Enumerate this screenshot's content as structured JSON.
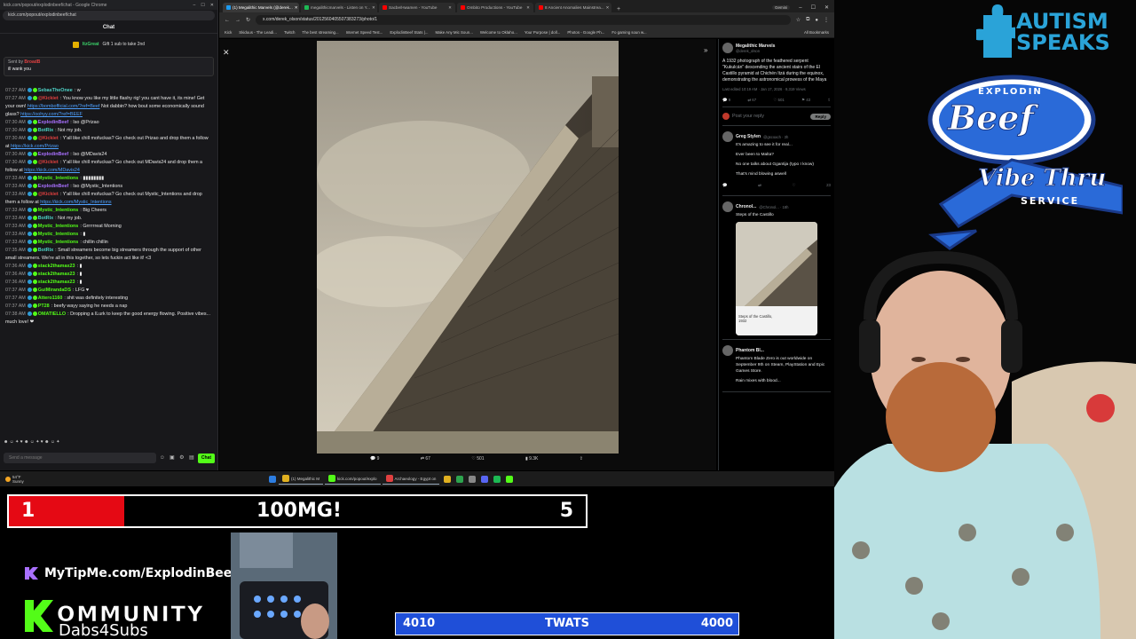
{
  "chat": {
    "window_title": "kick.com/popout/explodinbeef/chat - Google Chrome",
    "url": "kick.com/popout/explodinbeef/chat",
    "header": "Chat",
    "pinned": {
      "user": "ItzGreat",
      "text": "Gift 1 sub to take 2nd"
    },
    "reply": {
      "sent_by": "Sent by",
      "sender": "BroadB",
      "message": "ill wank you"
    },
    "messages": [
      {
        "time": "07:27 AM",
        "user": "SebasTheOnee",
        "color": "#4ed4c8",
        "text": "w"
      },
      {
        "time": "07:27 AM",
        "user": "@Kickiet",
        "color": "#e04040",
        "text": "You know you like my little flashy rig! you cant have it, its mine! Get your own!",
        "link": "https://bombofficial.com/?ref=Beef",
        "after": "Not dabbin? how bout some economically sound glass?",
        "link2": "https://oohyy.com/?ref=BEEF"
      },
      {
        "time": "07:30 AM",
        "user": "ExplodinBeef",
        "color": "#a970ff",
        "text": "Iso @Prizao"
      },
      {
        "time": "07:30 AM",
        "user": "BotRix",
        "color": "#4ed4c8",
        "text": "Not my job."
      },
      {
        "time": "07:30 AM",
        "user": "@Kickiet",
        "color": "#e04040",
        "text": "Y'all like chill mofuckas? Go check out Prizao and drop them a follow at",
        "link": "https://kick.com/Prizao"
      },
      {
        "time": "07:30 AM",
        "user": "ExplodinBeef",
        "color": "#a970ff",
        "text": "Iso @MDavis24"
      },
      {
        "time": "07:30 AM",
        "user": "@Kickiet",
        "color": "#e04040",
        "text": "Y'all like chill mofuckas? Go check out MDavis24 and drop them a follow at",
        "link": "https://kick.com/MDavis24"
      },
      {
        "time": "07:33 AM",
        "user": "Mystic_Intentions",
        "color": "#53fc18",
        "text": "▮▮▮▮▮▮▮▮"
      },
      {
        "time": "07:33 AM",
        "user": "ExplodinBeef",
        "color": "#a970ff",
        "text": "Iso @Mystic_Intentions"
      },
      {
        "time": "07:33 AM",
        "user": "@Kickiet",
        "color": "#e04040",
        "text": "Y'all like chill mofuckas? Go check out Mystic_Intentions and drop them a follow at",
        "link": "https://kick.com/Mystic_Intentions"
      },
      {
        "time": "07:33 AM",
        "user": "Mystic_Intentions",
        "color": "#53fc18",
        "text": "Big Cheers"
      },
      {
        "time": "07:33 AM",
        "user": "BotRix",
        "color": "#4ed4c8",
        "text": "Not my job."
      },
      {
        "time": "07:33 AM",
        "user": "Mystic_Intentions",
        "color": "#53fc18",
        "text": "Grrrrrreat Morning"
      },
      {
        "time": "07:33 AM",
        "user": "Mystic_Intentions",
        "color": "#53fc18",
        "text": "▮"
      },
      {
        "time": "07:33 AM",
        "user": "Mystic_Intentions",
        "color": "#53fc18",
        "text": "chillin chillin"
      },
      {
        "time": "07:35 AM",
        "user": "BotRix",
        "color": "#4ed4c8",
        "text": "Small streamers become big streamers through the support of other small streamers. We're all in this together, so lets fuckin act like it! <3"
      },
      {
        "time": "07:36 AM",
        "user": "stack2thamax23",
        "color": "#53fc18",
        "text": "▮"
      },
      {
        "time": "07:36 AM",
        "user": "stack2thamax23",
        "color": "#53fc18",
        "text": "▮"
      },
      {
        "time": "07:36 AM",
        "user": "stack2thamax23",
        "color": "#53fc18",
        "text": "▮"
      },
      {
        "time": "07:37 AM",
        "user": "GuiMirandaDS",
        "color": "#53fc18",
        "text": "LFG ♥"
      },
      {
        "time": "07:37 AM",
        "user": "Attero1160",
        "color": "#53fc18",
        "text": "shit was definitely interesting"
      },
      {
        "time": "07:37 AM",
        "user": "PT28",
        "color": "#53fc18",
        "text": "beefy wayy saying he needs a nap"
      },
      {
        "time": "07:38 AM",
        "user": "OMATIELLO",
        "color": "#53fc18",
        "text": "Dropping a lLurk to keep the good energy flowing. Positive vibes... much love! ❤"
      }
    ],
    "input_placeholder": "Send a message",
    "send_label": "Chat"
  },
  "browser": {
    "tabs": [
      {
        "label": "(1) Megalithic Marvels (@derek...",
        "color": "#1d9bf0",
        "active": true
      },
      {
        "label": "megalithicmarvels - Listen on Y...",
        "color": "#1db954",
        "active": false
      },
      {
        "label": "Sacbe/Hwamen - YouTube",
        "color": "#ff0000",
        "active": false
      },
      {
        "label": "Ombito Productions - YouTube",
        "color": "#ff0000",
        "active": false
      },
      {
        "label": "8 Ancient Anomalies Mainstrea...",
        "color": "#ff0000",
        "active": false
      }
    ],
    "gemini_label": "Gemini",
    "url": "x.com/derek_olson/status/2012560405507383273/photo/1",
    "bookmarks": [
      "Kick",
      "Skiduus - The Leadi...",
      "Twitch",
      "The best streaming...",
      "Internet Speed Test...",
      "ExplodinBeef Stats |...",
      "Make Any Mic Soun...",
      "Welcome to Oklaho...",
      "Your Purpose | doll...",
      "Photos - Google Ph...",
      "Fo gaming soun w..."
    ],
    "all_bookmarks": "All Bookmarks",
    "photo_actions": {
      "replies": "9",
      "reposts": "67",
      "likes": "501",
      "views": "9.3K"
    },
    "tweet": {
      "name": "Megalithic Marvels",
      "handle": "@derek_olson",
      "text": "A 1932 photograph of the feathered serpent \"Kukulcán\" descending the ancient stairs of the El Castillo pyramid at Chichén Itzá during the equinox, demonstrating the astronomical prowess of the Maya",
      "meta": "Last edited 10:19 AM · Jan 17, 2026 · 9,319 Views",
      "stats": {
        "replies": "9",
        "reposts": "67",
        "likes": "501",
        "bookmarks": "43"
      },
      "reply_placeholder": "Post your reply",
      "reply_button": "Reply"
    },
    "replies": [
      {
        "name": "Greg Stylen",
        "handle": "@gscoach · 3h",
        "lines": [
          "It's amazing to see it for real...",
          "Ever been to Malta?",
          "No one talks about Ggantija (typo I know)",
          "That's mind blowing aswell"
        ],
        "stats": "23"
      },
      {
        "name": "Chronol...",
        "handle": "@Chronol... · 18h",
        "lines": [
          "Steps of the Castillo"
        ],
        "thumb_caption": "Steps of the Castillo, 1932",
        "stats": ""
      },
      {
        "name": "Phantom Bl...",
        "handle": "",
        "lines": [
          "Phantom Blade Zero is out worldwide on September 9th on Steam, PlayStation and Epic Games Store.",
          "Rain mixes with blood..."
        ],
        "stats": ""
      }
    ]
  },
  "taskbar": {
    "weather_temp": "54°F",
    "weather_desc": "Sunny",
    "apps": [
      "(1) Megalithic M",
      "kick.com/popout/explo",
      "Archaeology - Egypt on"
    ]
  },
  "overlay": {
    "goal_left": "1",
    "goal_title": "100MG!",
    "goal_right": "5",
    "goal_progress": 0.2,
    "goal_color": "#e50914",
    "tip_text": "MyTipMe.com/ExplodinBeef",
    "kommunity_word": "OMMUNITY",
    "kommunity_sub": "Dabs4Subs",
    "counter_left": "4010",
    "counter_title": "TWATS",
    "counter_right": "4000",
    "counter_color": "#1f4fd8",
    "autism_line1": "AUTISM",
    "autism_line2": "SPEAKS",
    "beef_explodin": "EXPLODIN",
    "beef_word": "Beef",
    "beef_vibe": "Vibe Thru",
    "beef_service": "SERVICE"
  }
}
